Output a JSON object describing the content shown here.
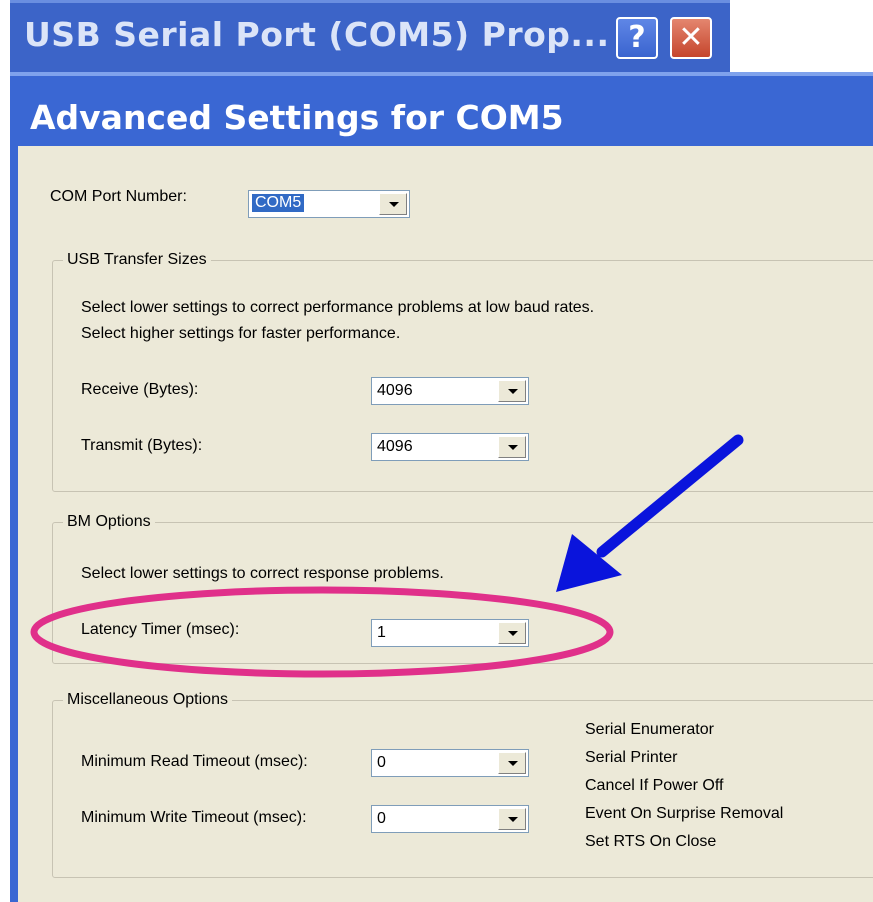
{
  "background_window": {
    "title": "USB Serial Port (COM5) Prop...",
    "help_label": "?",
    "close_label": "✕"
  },
  "dialog": {
    "title": "Advanced Settings for COM5"
  },
  "com_port": {
    "label": "COM Port Number:",
    "value": "COM5"
  },
  "usb_transfer": {
    "title": "USB Transfer Sizes",
    "desc1": "Select lower settings to correct performance problems at low baud rates.",
    "desc2": "Select higher settings for faster performance.",
    "receive_label": "Receive (Bytes):",
    "receive_value": "4096",
    "transmit_label": "Transmit (Bytes):",
    "transmit_value": "4096"
  },
  "bm_options": {
    "title": "BM Options",
    "desc": "Select lower settings to correct response problems.",
    "latency_label": "Latency Timer (msec):",
    "latency_value": "1"
  },
  "misc": {
    "title": "Miscellaneous Options",
    "min_read_label": "Minimum Read Timeout (msec):",
    "min_read_value": "0",
    "min_write_label": "Minimum Write Timeout (msec):",
    "min_write_value": "0",
    "options": [
      "Serial Enumerator",
      "Serial Printer",
      "Cancel If Power Off",
      "Event On Surprise Removal",
      "Set RTS On Close"
    ]
  },
  "colors": {
    "title_bar": "#3a67d3",
    "dialog_face": "#ece9d8",
    "annotation_arrow": "#0a14dc",
    "annotation_ellipse": "#e0308a"
  }
}
